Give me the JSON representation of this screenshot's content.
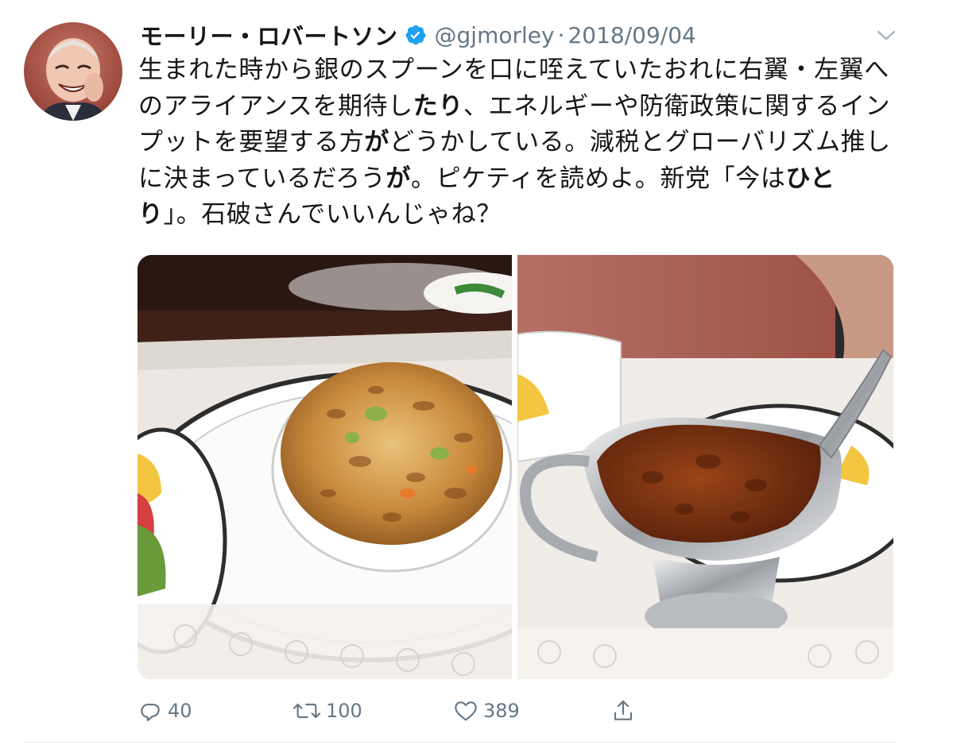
{
  "tweet": {
    "author": {
      "display_name": "モーリー・ロバートソン",
      "verified_icon": "verified-badge-icon",
      "handle": "@gjmorley",
      "separator": "·",
      "date": "2018/09/04"
    },
    "text_segments": [
      {
        "t": "生まれた時から銀のスプーンを口に咥えていたおれに右翼・左翼へのアライアンスを期待し",
        "bold": false
      },
      {
        "t": "たり",
        "bold": true
      },
      {
        "t": "、エネルギーや防衛政策に関するインプットを要望する方",
        "bold": false
      },
      {
        "t": "が",
        "bold": true
      },
      {
        "t": "どうかしている。減税とグローバリズム推しに決まっているだろう",
        "bold": false
      },
      {
        "t": "が",
        "bold": true
      },
      {
        "t": "。ピケティを読めよ。新党「今は",
        "bold": false
      },
      {
        "t": "ひとり",
        "bold": true
      },
      {
        "t": "」。石破さんでいいんじゃね？",
        "bold": false
      }
    ],
    "media": [
      {
        "description": "gratin dish on plate",
        "icon": "photo"
      },
      {
        "description": "curry sauce gravy boat",
        "icon": "photo"
      }
    ],
    "actions": {
      "reply_count": "40",
      "retweet_count": "100",
      "like_count": "389"
    }
  },
  "colors": {
    "text_primary": "#14171a",
    "text_secondary": "#657786",
    "verified_blue": "#1da1f2",
    "divider": "#e6ecf0"
  }
}
